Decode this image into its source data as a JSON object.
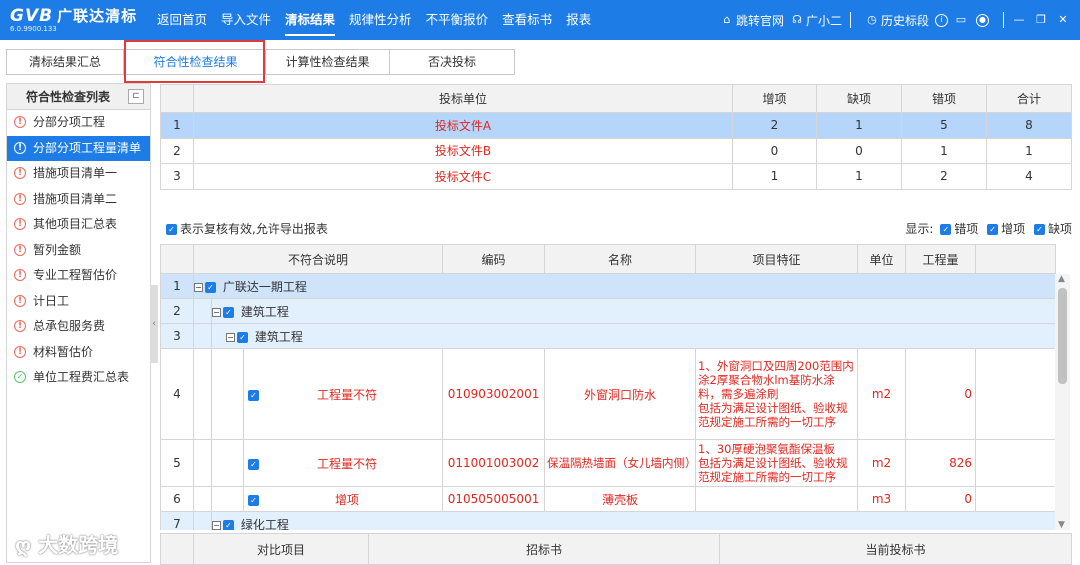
{
  "app": {
    "logo": "GVB",
    "name": "广联达清标",
    "version": "6.0.9900.133"
  },
  "nav": [
    "返回首页",
    "导入文件",
    "清标结果",
    "规律性分析",
    "不平衡报价",
    "查看标书",
    "报表"
  ],
  "nav_active_index": 2,
  "right_tools": {
    "official_site": "跳转官网",
    "assistant": "广小二",
    "history": "历史标段"
  },
  "tabs": [
    "清标结果汇总",
    "符合性检查结果",
    "计算性检查结果",
    "否决投标"
  ],
  "active_tab_index": 1,
  "left_panel": {
    "title": "符合性检查列表",
    "items": [
      "分部分项工程",
      "分部分项工程量清单",
      "措施项目清单一",
      "措施项目清单二",
      "其他项目汇总表",
      "暂列金额",
      "专业工程暂估价",
      "计日工",
      "总承包服务费",
      "材料暂估价",
      "单位工程费汇总表"
    ],
    "selected_index": 1
  },
  "watermark": "大数跨境",
  "bidders_table": {
    "headers": [
      "投标单位",
      "增项",
      "缺项",
      "错项",
      "合计"
    ],
    "rows": [
      {
        "idx": "1",
        "unit": "投标文件A",
        "add": "2",
        "missing": "1",
        "wrong": "5",
        "total": "8"
      },
      {
        "idx": "2",
        "unit": "投标文件B",
        "add": "0",
        "missing": "0",
        "wrong": "1",
        "total": "1"
      },
      {
        "idx": "3",
        "unit": "投标文件C",
        "add": "1",
        "missing": "1",
        "wrong": "2",
        "total": "4"
      }
    ]
  },
  "check_bar": {
    "left_label": "表示复核有效,允许导出报表",
    "display_label": "显示:",
    "options": [
      "错项",
      "增项",
      "缺项"
    ]
  },
  "detail_table": {
    "headers": [
      "不符合说明",
      "编码",
      "名称",
      "项目特征",
      "单位",
      "工程量"
    ],
    "tree": [
      {
        "idx": "1",
        "label": "广联达一期工程"
      },
      {
        "idx": "2",
        "label": "建筑工程"
      },
      {
        "idx": "3",
        "label": "建筑工程"
      }
    ],
    "rows": [
      {
        "idx": "4",
        "desc": "工程量不符",
        "code": "010903002001",
        "name": "外窗洞口防水",
        "feature": "1、外窗洞口及四周200范围内涂2厚聚合物水lm基防水涂料，需多遍涂刷\n包括为满足设计图纸、验收规范规定施工所需的一切工序",
        "unit": "m2",
        "qty": "0"
      },
      {
        "idx": "5",
        "desc": "工程量不符",
        "code": "011001003002",
        "name": "保温隔热墙面（女儿墙内侧）",
        "feature": "1、30厚硬泡聚氨酯保温板\n包括为满足设计图纸、验收规范规定施工所需的一切工序",
        "unit": "m2",
        "qty": "826"
      },
      {
        "idx": "6",
        "desc": "增项",
        "code": "010505005001",
        "name": "薄壳板",
        "feature": "",
        "unit": "m3",
        "qty": "0"
      }
    ],
    "partial": {
      "idx": "7",
      "label": "绿化工程"
    }
  },
  "compare_table": {
    "headers": [
      "对比项目",
      "招标书",
      "当前投标书"
    ]
  }
}
